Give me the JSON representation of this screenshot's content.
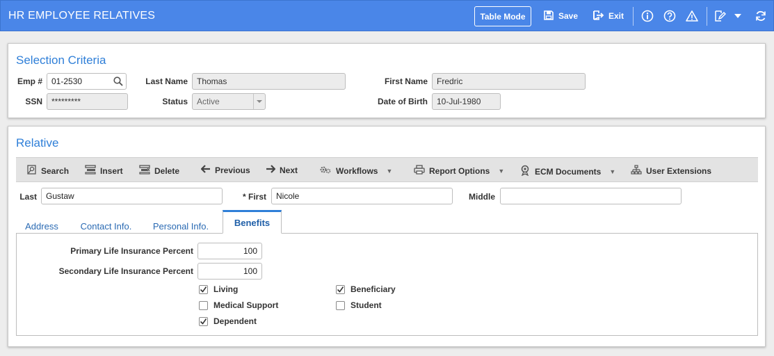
{
  "header": {
    "title": "HR EMPLOYEE RELATIVES",
    "table_mode_label": "Table Mode",
    "save_label": "Save",
    "exit_label": "Exit",
    "icons": [
      "info-icon",
      "help-icon",
      "warning-icon",
      "edit-icon",
      "chevron-down-icon",
      "refresh-icon"
    ]
  },
  "selection": {
    "title": "Selection Criteria",
    "emp_label": "Emp #",
    "emp_value": "01-2530",
    "last_name_label": "Last Name",
    "last_name_value": "Thomas",
    "first_name_label": "First Name",
    "first_name_value": "Fredric",
    "ssn_label": "SSN",
    "ssn_value": "*********",
    "status_label": "Status",
    "status_value": "Active",
    "dob_label": "Date of Birth",
    "dob_value": "10-Jul-1980"
  },
  "relative": {
    "title": "Relative",
    "toolbar": {
      "search": "Search",
      "insert": "Insert",
      "delete": "Delete",
      "previous": "Previous",
      "next": "Next",
      "workflows": "Workflows",
      "report_options": "Report Options",
      "ecm_documents": "ECM Documents",
      "user_extensions": "User Extensions"
    },
    "last_label": "Last",
    "last_value": "Gustaw",
    "first_label": "* First",
    "first_value": "Nicole",
    "middle_label": "Middle",
    "middle_value": "",
    "tabs": [
      "Address",
      "Contact Info.",
      "Personal Info.",
      "Benefits"
    ],
    "active_tab": "Benefits",
    "benefits": {
      "primary_label": "Primary Life Insurance Percent",
      "primary_value": "100",
      "secondary_label": "Secondary Life Insurance Percent",
      "secondary_value": "100",
      "living_label": "Living",
      "living_checked": true,
      "medical_label": "Medical Support",
      "medical_checked": false,
      "dependent_label": "Dependent",
      "dependent_checked": true,
      "beneficiary_label": "Beneficiary",
      "beneficiary_checked": true,
      "student_label": "Student",
      "student_checked": false
    }
  },
  "colors": {
    "header_blue": "#4a86e8",
    "title_blue": "#2f7fd8"
  }
}
